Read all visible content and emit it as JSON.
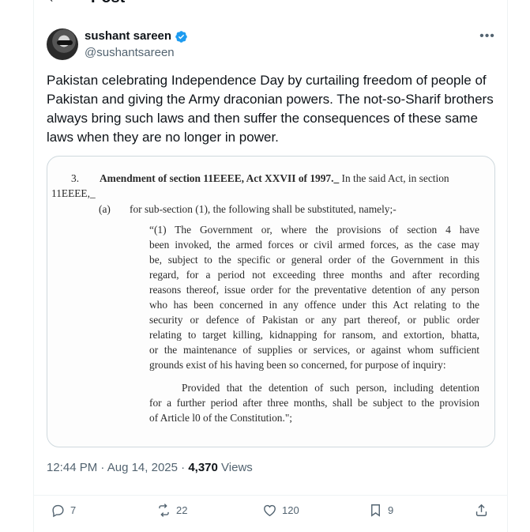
{
  "header": {
    "title": "Post"
  },
  "author": {
    "name": "sushant sareen",
    "handle": "@sushantsareen"
  },
  "tweet": {
    "text": "Pakistan celebrating Independence Day by curtailing freedom of people of Pakistan and giving the Army draconian powers. The not-so-Sharif brothers always bring such laws and then suffer the consequences of these same laws when they are no longer in power."
  },
  "document": {
    "section_number": "3.",
    "heading": "Amendment of section 11EEEE, Act XXVII of 1997._",
    "heading_tail": " In the said Act, in section",
    "heading_cont": "11EEEE,_",
    "sub_label": "(a)",
    "sub_text": "for sub-section (1), the following shall be substituted, namely;-",
    "quote_lines": [
      "“(1) The Government or, where the provisions of section 4 have",
      "been invoked, the armed forces or civil armed forces, as the case may",
      "be, subject to the specific or general order of the Government in this",
      "regard, for a period not exceeding three months and after recording",
      "reasons thereof, issue order for the preventative detention of any person",
      "who has been concerned in any offence under this Act relating to the",
      "security or defence of Pakistan or any part thereof, or public order",
      "relating to target killing, kidnapping for ransom, and extortion, bhatta,",
      "or the maintenance of supplies or services, or against whom sufficient",
      "grounds exist of his having been so concerned, for purpose of inquiry:"
    ],
    "proviso_lines": [
      "Provided that the detention of such person, including detention",
      "for a further period after three months, shall be subject to the provision",
      "of Article l0 of the Constitution.\";"
    ]
  },
  "meta": {
    "time": "12:44 PM",
    "sep1": " · ",
    "date": "Aug 14, 2025",
    "sep2": " · ",
    "views_count": "4,370",
    "views_label": " Views"
  },
  "actions": {
    "replies": "7",
    "reposts": "22",
    "likes": "120",
    "bookmarks": "9"
  },
  "colors": {
    "text": "#0f1419",
    "secondary": "#536471",
    "verified": "#1d9bf0",
    "border": "#cfd9de"
  },
  "icons": [
    "back-arrow-icon",
    "verified-icon",
    "more-icon",
    "reply-icon",
    "repost-icon",
    "like-icon",
    "bookmark-icon",
    "share-icon"
  ]
}
